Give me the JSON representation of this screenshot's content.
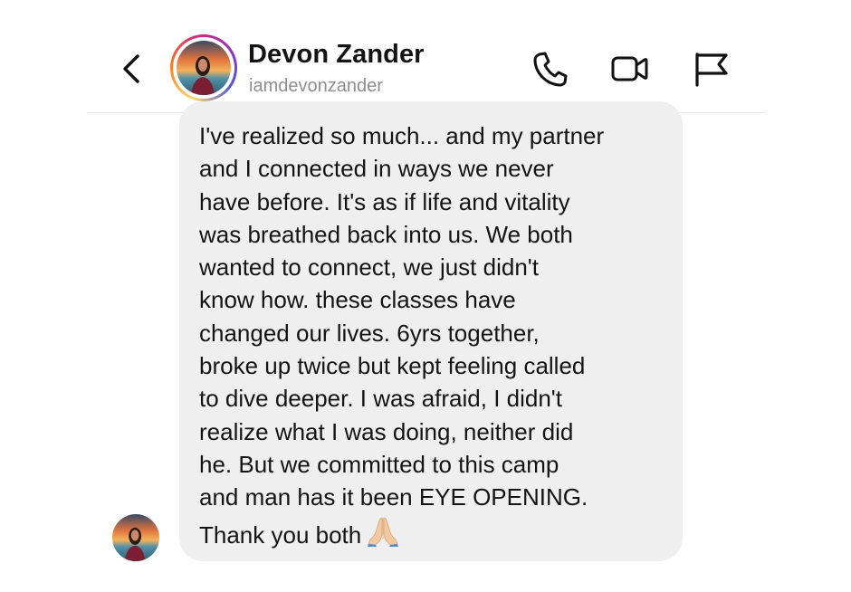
{
  "header": {
    "contact_name": "Devon Zander",
    "username": "iamdevonzander",
    "icons": {
      "back": "chevron-left-icon",
      "call": "phone-icon",
      "video": "video-camera-icon",
      "report": "flag-icon"
    }
  },
  "message": {
    "lines": [
      "I've realized so much... and my partner",
      "and I connected in ways we never",
      "have before. It's as if life and vitality",
      "was breathed back into us. We both",
      "wanted to connect, we just didn't",
      "know how. these classes have",
      "changed our lives. 6yrs together,",
      "broke up twice but kept feeling called",
      "to dive deeper. I was afraid, I didn't",
      "realize what I was doing, neither did",
      "he. But we committed to this camp",
      "and man has it been EYE OPENING.",
      "Thank you both"
    ],
    "emoji": "folded-hands-icon"
  },
  "colors": {
    "bubble": "#efefef",
    "text": "#141414",
    "secondary_text": "#8e8e8e",
    "story_ring_start": "#feda75",
    "story_ring_end": "#962fbf"
  }
}
